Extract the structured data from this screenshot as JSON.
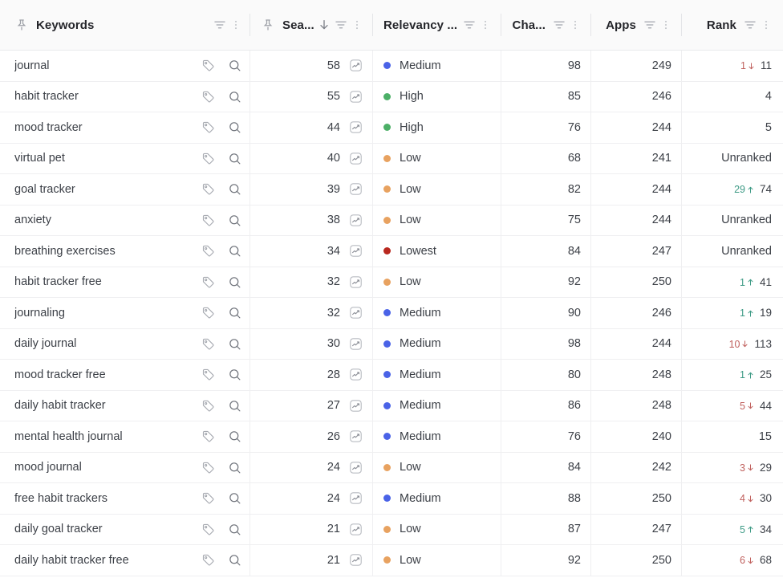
{
  "table": {
    "columns": [
      {
        "key": "keywords",
        "label": "Keywords",
        "pinned": true,
        "has_filter": true,
        "has_menu": true,
        "sorted": false,
        "align": "left"
      },
      {
        "key": "search",
        "label": "Sea...",
        "pinned": true,
        "has_filter": true,
        "has_menu": true,
        "sorted": true,
        "sort_dir": "desc",
        "align": "right"
      },
      {
        "key": "relevancy",
        "label": "Relevancy ...",
        "pinned": false,
        "has_filter": true,
        "has_menu": true,
        "sorted": false,
        "align": "left"
      },
      {
        "key": "chance",
        "label": "Cha...",
        "pinned": false,
        "has_filter": true,
        "has_menu": true,
        "sorted": false,
        "align": "right"
      },
      {
        "key": "apps",
        "label": "Apps",
        "pinned": false,
        "has_filter": true,
        "has_menu": true,
        "sorted": false,
        "align": "right"
      },
      {
        "key": "rank",
        "label": "Rank",
        "pinned": false,
        "has_filter": true,
        "has_menu": true,
        "sorted": false,
        "align": "right"
      }
    ],
    "icons": {
      "pin": "pin-icon",
      "filter": "filter-icon",
      "menu": "kebab-menu-icon",
      "sort_desc": "arrow-down-icon",
      "tag": "tag-icon",
      "search": "magnifier-icon",
      "trend": "trend-chart-icon",
      "rank_up": "arrow-up-icon",
      "rank_down": "arrow-down-icon"
    },
    "relevancy_colors": {
      "High": "#4caf67",
      "Medium": "#4a63e7",
      "Low": "#e8a260",
      "Lowest": "#b9281f"
    },
    "delta_colors": {
      "up": "#3f9b86",
      "down": "#c0615e"
    },
    "unranked_label": "Unranked",
    "rows": [
      {
        "keyword": "journal",
        "search": 58,
        "relevancy": "Medium",
        "chance": 98,
        "apps": 249,
        "rank": "11",
        "delta": 1,
        "delta_dir": "down"
      },
      {
        "keyword": "habit tracker",
        "search": 55,
        "relevancy": "High",
        "chance": 85,
        "apps": 246,
        "rank": "4",
        "delta": null,
        "delta_dir": null
      },
      {
        "keyword": "mood tracker",
        "search": 44,
        "relevancy": "High",
        "chance": 76,
        "apps": 244,
        "rank": "5",
        "delta": null,
        "delta_dir": null
      },
      {
        "keyword": "virtual pet",
        "search": 40,
        "relevancy": "Low",
        "chance": 68,
        "apps": 241,
        "rank": "Unranked",
        "delta": null,
        "delta_dir": null
      },
      {
        "keyword": "goal tracker",
        "search": 39,
        "relevancy": "Low",
        "chance": 82,
        "apps": 244,
        "rank": "74",
        "delta": 29,
        "delta_dir": "up"
      },
      {
        "keyword": "anxiety",
        "search": 38,
        "relevancy": "Low",
        "chance": 75,
        "apps": 244,
        "rank": "Unranked",
        "delta": null,
        "delta_dir": null
      },
      {
        "keyword": "breathing exercises",
        "search": 34,
        "relevancy": "Lowest",
        "chance": 84,
        "apps": 247,
        "rank": "Unranked",
        "delta": null,
        "delta_dir": null
      },
      {
        "keyword": "habit tracker free",
        "search": 32,
        "relevancy": "Low",
        "chance": 92,
        "apps": 250,
        "rank": "41",
        "delta": 1,
        "delta_dir": "up"
      },
      {
        "keyword": "journaling",
        "search": 32,
        "relevancy": "Medium",
        "chance": 90,
        "apps": 246,
        "rank": "19",
        "delta": 1,
        "delta_dir": "up"
      },
      {
        "keyword": "daily journal",
        "search": 30,
        "relevancy": "Medium",
        "chance": 98,
        "apps": 244,
        "rank": "113",
        "delta": 10,
        "delta_dir": "down"
      },
      {
        "keyword": "mood tracker free",
        "search": 28,
        "relevancy": "Medium",
        "chance": 80,
        "apps": 248,
        "rank": "25",
        "delta": 1,
        "delta_dir": "up"
      },
      {
        "keyword": "daily habit tracker",
        "search": 27,
        "relevancy": "Medium",
        "chance": 86,
        "apps": 248,
        "rank": "44",
        "delta": 5,
        "delta_dir": "down"
      },
      {
        "keyword": "mental health journal",
        "search": 26,
        "relevancy": "Medium",
        "chance": 76,
        "apps": 240,
        "rank": "15",
        "delta": null,
        "delta_dir": null
      },
      {
        "keyword": "mood journal",
        "search": 24,
        "relevancy": "Low",
        "chance": 84,
        "apps": 242,
        "rank": "29",
        "delta": 3,
        "delta_dir": "down"
      },
      {
        "keyword": "free habit trackers",
        "search": 24,
        "relevancy": "Medium",
        "chance": 88,
        "apps": 250,
        "rank": "30",
        "delta": 4,
        "delta_dir": "down"
      },
      {
        "keyword": "daily goal tracker",
        "search": 21,
        "relevancy": "Low",
        "chance": 87,
        "apps": 247,
        "rank": "34",
        "delta": 5,
        "delta_dir": "up"
      },
      {
        "keyword": "daily habit tracker free",
        "search": 21,
        "relevancy": "Low",
        "chance": 92,
        "apps": 250,
        "rank": "68",
        "delta": 6,
        "delta_dir": "down"
      }
    ]
  }
}
